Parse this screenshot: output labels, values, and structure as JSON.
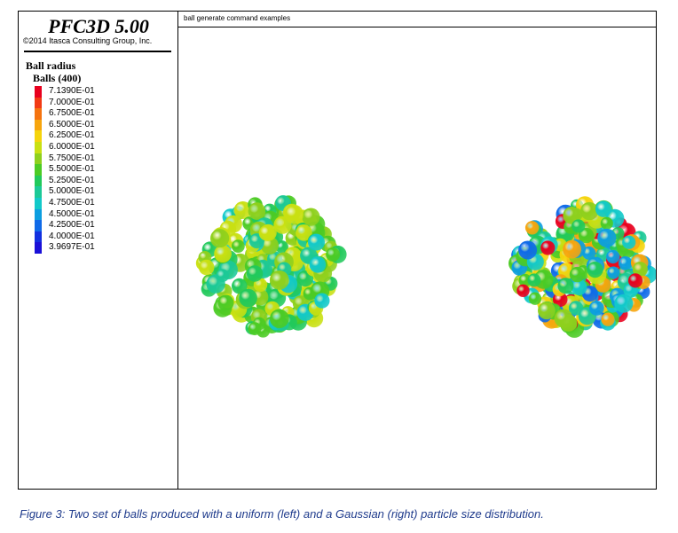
{
  "app": {
    "title": "PFC3D 5.00",
    "copyright": "©2014 Itasca Consulting Group, Inc."
  },
  "legend": {
    "title": "Ball radius",
    "subtitle": "Balls (400)",
    "items": [
      {
        "label": "7.1390E-01",
        "color": "#e8001e"
      },
      {
        "label": "7.0000E-01",
        "color": "#f23a14"
      },
      {
        "label": "6.7500E-01",
        "color": "#f5730f"
      },
      {
        "label": "6.5000E-01",
        "color": "#f7a50d"
      },
      {
        "label": "6.2500E-01",
        "color": "#f5d40c"
      },
      {
        "label": "6.0000E-01",
        "color": "#c9e012"
      },
      {
        "label": "5.7500E-01",
        "color": "#8ed01d"
      },
      {
        "label": "5.5000E-01",
        "color": "#4ccb24"
      },
      {
        "label": "5.2500E-01",
        "color": "#21c95b"
      },
      {
        "label": "5.0000E-01",
        "color": "#1cc997"
      },
      {
        "label": "4.7500E-01",
        "color": "#12c9c9"
      },
      {
        "label": "4.5000E-01",
        "color": "#0c9ee0"
      },
      {
        "label": "4.2500E-01",
        "color": "#0f6ae8"
      },
      {
        "label": "4.0000E-01",
        "color": "#1230e0"
      },
      {
        "label": "3.9697E-01",
        "color": "#1a10d8"
      }
    ]
  },
  "viewport": {
    "title": "ball generate command examples"
  },
  "caption": "Figure 3: Two set of balls produced with a uniform (left) and a Gaussian (right) particle size distribution."
}
